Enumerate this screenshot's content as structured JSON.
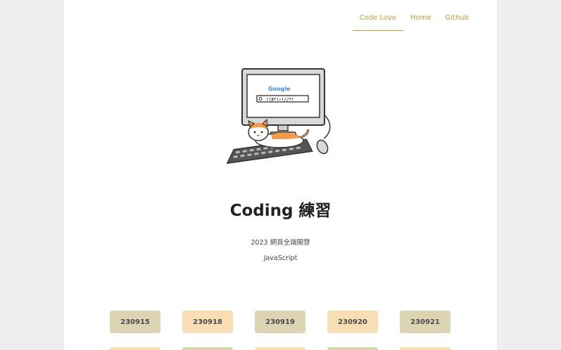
{
  "nav": {
    "items": [
      {
        "label": "Code Love",
        "active": true
      },
      {
        "label": "Home",
        "active": false
      },
      {
        "label": "Github",
        "active": false
      }
    ]
  },
  "hero": {
    "title": "Coding 練習",
    "subtitle": "2023 網頁全端開發",
    "tagline": "JavaScript",
    "illustration": "cat-on-keyboard-computer",
    "screen_text": "Google",
    "search_text": "!!X*!-!//*!"
  },
  "dates": [
    {
      "label": "230915",
      "color": "#ddd4b3"
    },
    {
      "label": "230918",
      "color": "#f7deb5"
    },
    {
      "label": "230919",
      "color": "#ddd4b3"
    },
    {
      "label": "230920",
      "color": "#f7deb5"
    },
    {
      "label": "230921",
      "color": "#ddd4b3"
    }
  ],
  "colors": {
    "accent": "#c9953a",
    "background": "#eeeeee",
    "card": "#ffffff"
  }
}
